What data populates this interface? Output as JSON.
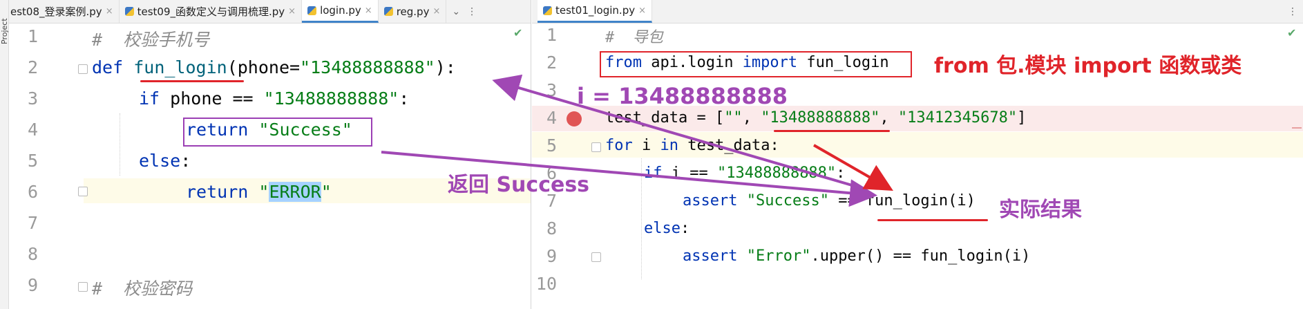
{
  "sidebar": {
    "label": "Project"
  },
  "left_tabs": [
    {
      "label": "est08_登录案例.py"
    },
    {
      "label": "test09_函数定义与调用梳理.py"
    },
    {
      "label": "login.py"
    },
    {
      "label": "reg.py"
    }
  ],
  "right_tabs": [
    {
      "label": "test01_login.py"
    }
  ],
  "tab_close": "×",
  "more_menu": "⋮",
  "left_editor": {
    "lines": [
      "1",
      "2",
      "3",
      "4",
      "5",
      "6",
      "7",
      "8",
      "9"
    ],
    "code": {
      "l1_comment": "#  校验手机号",
      "l2_def": "def",
      "l2_fn": "fun_login",
      "l2_rest1": "(phone=",
      "l2_str": "\"13488888888\"",
      "l2_rest2": "):",
      "l3_if": "if",
      "l3_rest": " phone == ",
      "l3_str": "\"13488888888\"",
      "l3_colon": ":",
      "l4_return": "return",
      "l4_str": "\"Success\"",
      "l5_else": "else",
      "l5_colon": ":",
      "l6_return": "return",
      "l6_q1": "\"",
      "l6_sel": "ERROR",
      "l6_q2": "\"",
      "l9_comment": "#  校验密码"
    }
  },
  "right_editor": {
    "lines": [
      "1",
      "2",
      "3",
      "4",
      "5",
      "6",
      "7",
      "8",
      "9",
      "10"
    ],
    "code": {
      "l1_comment": "#  导包",
      "l2_from": "from",
      "l2_mid": " api.login ",
      "l2_import": "import",
      "l2_end": " fun_login",
      "l4_a": "test_data = [",
      "l4_s1": "\"\"",
      "l4_c1": ", ",
      "l4_s2": "\"13488888888\"",
      "l4_c2": ", ",
      "l4_s3": "\"13412345678\"",
      "l4_end": "]",
      "l5_for": "for",
      "l5_i": " i ",
      "l5_in": "in",
      "l5_rest": " test_data:",
      "l6_if": "if",
      "l6_rest": " i == ",
      "l6_str": "\"13488888888\"",
      "l6_colon": ":",
      "l7_assert": "assert",
      "l7_sp": " ",
      "l7_str": "\"Success\"",
      "l7_rest": " == fun_login(i)",
      "l8_else": "else",
      "l8_colon": ":",
      "l9_assert": "assert",
      "l9_sp": " ",
      "l9_str": "\"Error\"",
      "l9_rest": ".upper() == fun_login(i)"
    }
  },
  "annotations": {
    "import_note": "from 包.模块 import 函数或类",
    "i_value": "i = 13488888888",
    "return_note": "返回 Success",
    "actual_result": "实际结果"
  },
  "colors": {
    "annot_red": "#e0242a",
    "annot_purple": "#a048b4",
    "box_purple": "#9b3fb4",
    "breakpoint": "#e05555"
  }
}
